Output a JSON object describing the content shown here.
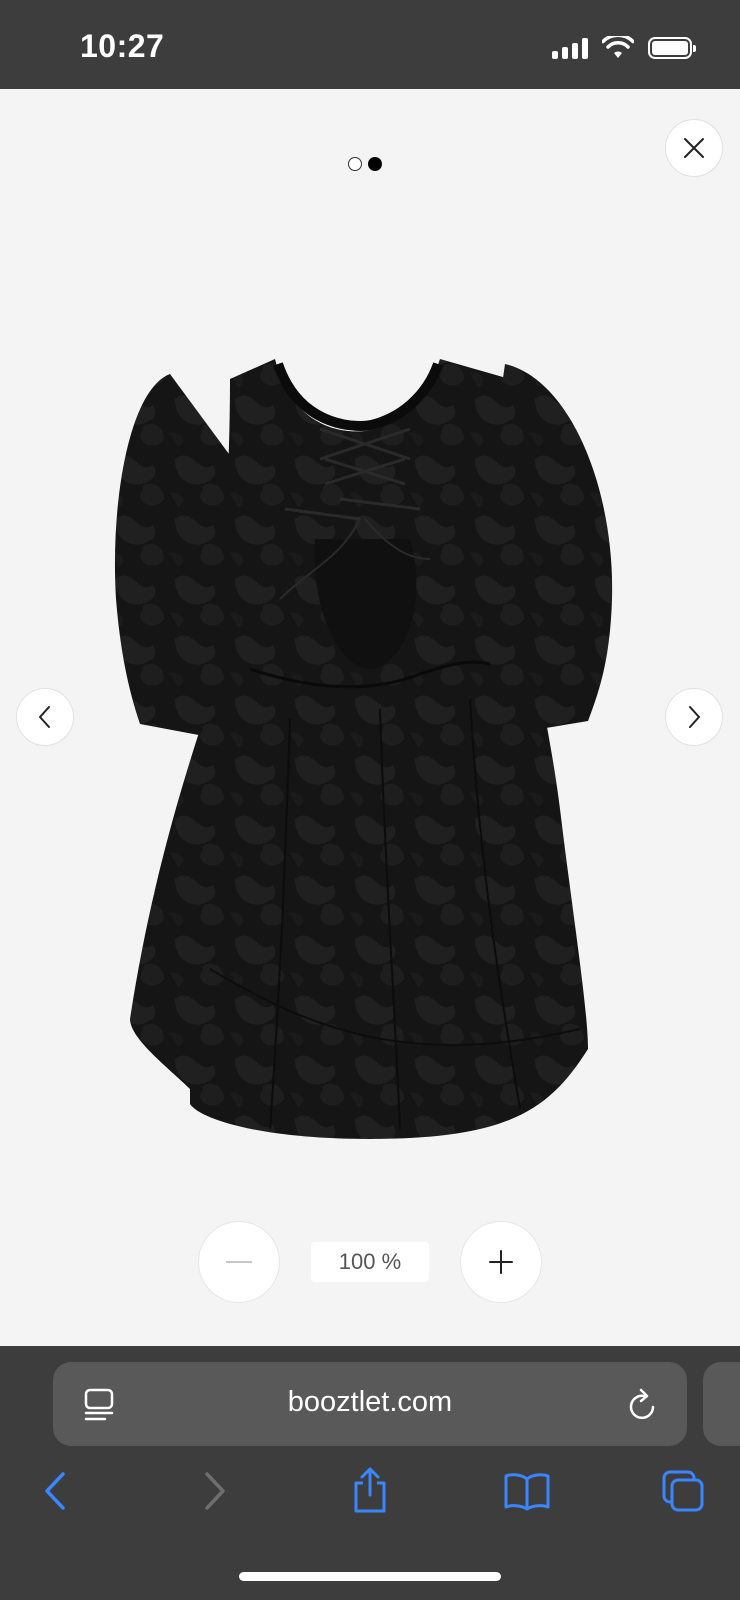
{
  "status_bar": {
    "time": "10:27"
  },
  "viewer": {
    "carousel": {
      "total": 2,
      "active_index": 1
    },
    "image_alt": "Black puff-sleeve dress, back view with lace-up cut-out",
    "zoom": {
      "level": "100 %"
    }
  },
  "browser": {
    "url": "booztlet.com",
    "accent_color": "#3a86ff"
  }
}
